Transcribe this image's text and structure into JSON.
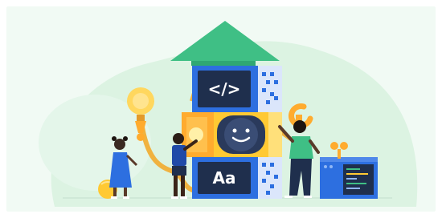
{
  "illustration": {
    "blocks": {
      "code_tag": "</>",
      "font_sample": "Aa"
    },
    "colors": {
      "background": "#f1faf4",
      "blob": "#dcf3e2",
      "roof_green": "#3fbf85",
      "block_blue": "#2d6fe0",
      "screen_dark": "#1f2f4d",
      "block_orange": "#ffab2e",
      "block_yellow": "#ffc933",
      "bulb": "#ffd75e",
      "pipe": "#f0b240"
    }
  }
}
